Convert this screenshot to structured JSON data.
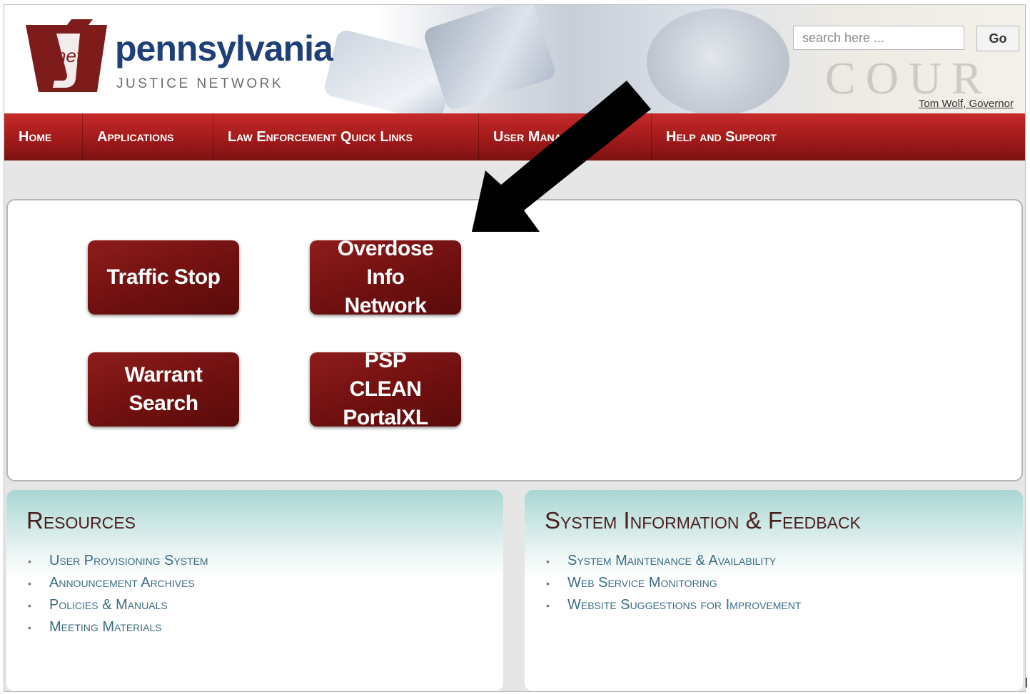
{
  "header": {
    "logo_jnet_text": "net",
    "logo_title": "pennsylvania",
    "logo_subtitle": "JUSTICE NETWORK",
    "search_placeholder": "search here ...",
    "go_label": "Go",
    "governor_link": "Tom Wolf, Governor",
    "background_text": "COUR"
  },
  "nav": {
    "items": [
      "Home",
      "Applications",
      "Law Enforcement Quick Links",
      "User Management",
      "Help and Support"
    ]
  },
  "quick_links": {
    "tiles": [
      "Traffic Stop",
      "Overdose Info Network",
      "Warrant Search",
      "PSP CLEAN PortalXL"
    ]
  },
  "resources": {
    "title": "Resources",
    "links": [
      "User Provisioning System",
      "Announcement Archives",
      "Policies & Manuals",
      "Meeting Materials"
    ]
  },
  "system_info": {
    "title": "System Information & Feedback",
    "links": [
      "System Maintenance & Availability",
      "Web Service Monitoring",
      "Website Suggestions for Improvement"
    ]
  },
  "colors": {
    "nav_red": "#a11a1a",
    "tile_maroon": "#6e0f0f",
    "logo_blue": "#1f3f79",
    "link_teal": "#3d6c80",
    "box_header_teal": "#a9d6d3"
  },
  "icons": {
    "annotation_arrow": "black-arrow-pointing-down-left",
    "list_bullet": "bullet-dot"
  }
}
